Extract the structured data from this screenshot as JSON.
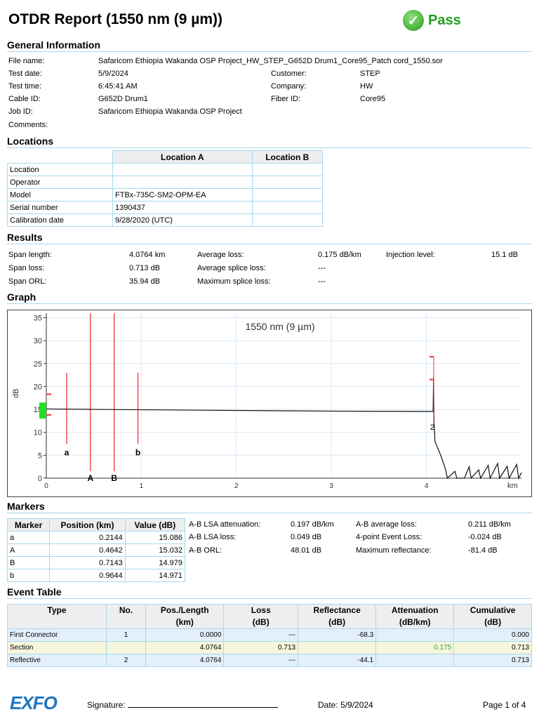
{
  "header": {
    "title": "OTDR Report (1550 nm (9 µm))",
    "status": "Pass"
  },
  "general": {
    "heading": "General Information",
    "file_name_label": "File name:",
    "file_name": "Safaricom Ethiopia Wakanda OSP Project_HW_STEP_G652D Drum1_Core95_Patch cord_1550.sor",
    "test_date_label": "Test date:",
    "test_date": "5/9/2024",
    "test_time_label": "Test time:",
    "test_time": "6:45:41 AM",
    "cable_id_label": "Cable ID:",
    "cable_id": "G652D Drum1",
    "job_id_label": "Job ID:",
    "job_id": "Safaricom Ethiopia Wakanda OSP Project",
    "comments_label": "Comments:",
    "customer_label": "Customer:",
    "customer": "STEP",
    "company_label": "Company:",
    "company": "HW",
    "fiber_id_label": "Fiber ID:",
    "fiber_id": "Core95"
  },
  "locations": {
    "heading": "Locations",
    "col_a": "Location A",
    "col_b": "Location B",
    "rows": [
      {
        "label": "Location",
        "a": "",
        "b": ""
      },
      {
        "label": "Operator",
        "a": "",
        "b": ""
      },
      {
        "label": "Model",
        "a": "FTBx-735C-SM2-OPM-EA",
        "b": ""
      },
      {
        "label": "Serial number",
        "a": "1390437",
        "b": ""
      },
      {
        "label": "Calibration date",
        "a": "9/28/2020 (UTC)",
        "b": ""
      }
    ]
  },
  "results": {
    "heading": "Results",
    "span_length_label": "Span length:",
    "span_length": "4.0764 km",
    "span_loss_label": "Span loss:",
    "span_loss": "0.713 dB",
    "span_orl_label": "Span ORL:",
    "span_orl": "35.94 dB",
    "avg_loss_label": "Average loss:",
    "avg_loss": "0.175 dB/km",
    "avg_splice_label": "Average splice loss:",
    "avg_splice": "---",
    "max_splice_label": "Maximum splice loss:",
    "max_splice": "---",
    "injection_label": "Injection level:",
    "injection": "15.1 dB"
  },
  "graph": {
    "heading": "Graph"
  },
  "chart_data": {
    "type": "line",
    "title": "1550 nm (9 µm)",
    "xlabel": "km",
    "ylabel": "dB",
    "xlim": [
      0,
      5
    ],
    "ylim": [
      0,
      36
    ],
    "xticks": [
      "0",
      "1",
      "2",
      "3",
      "4"
    ],
    "yticks": [
      "0",
      "5",
      "10",
      "15",
      "20",
      "25",
      "30",
      "35"
    ],
    "trace": [
      [
        0,
        15.1
      ],
      [
        0.5,
        15.0
      ],
      [
        1.5,
        14.85
      ],
      [
        3.2,
        14.6
      ],
      [
        4.07,
        14.55
      ],
      [
        4.075,
        22
      ],
      [
        4.08,
        12
      ],
      [
        4.09,
        8
      ],
      [
        4.15,
        5
      ],
      [
        4.2,
        2
      ],
      [
        4.22,
        0
      ],
      [
        4.3,
        1.5
      ],
      [
        4.32,
        0
      ],
      [
        4.4,
        0
      ],
      [
        4.45,
        2.5
      ],
      [
        4.47,
        0
      ],
      [
        4.55,
        1.8
      ],
      [
        4.57,
        0
      ],
      [
        4.65,
        2.8
      ],
      [
        4.67,
        0
      ],
      [
        4.75,
        3.2
      ],
      [
        4.77,
        0
      ],
      [
        4.85,
        2.6
      ],
      [
        4.87,
        0
      ],
      [
        4.95,
        3
      ],
      [
        4.97,
        0
      ],
      [
        5,
        1.2
      ]
    ],
    "markers": [
      {
        "label": "a",
        "x": 0.2144
      },
      {
        "label": "A",
        "x": 0.4642
      },
      {
        "label": "B",
        "x": 0.7143
      },
      {
        "label": "b",
        "x": 0.9644
      }
    ],
    "event_label": "2"
  },
  "markers": {
    "heading": "Markers",
    "cols": [
      "Marker",
      "Position (km)",
      "Value (dB)"
    ],
    "rows": [
      {
        "m": "a",
        "p": "0.2144",
        "v": "15.086"
      },
      {
        "m": "A",
        "p": "0.4642",
        "v": "15.032"
      },
      {
        "m": "B",
        "p": "0.7143",
        "v": "14.979"
      },
      {
        "m": "b",
        "p": "0.9644",
        "v": "14.971"
      }
    ],
    "lsa_att_label": "A-B LSA attenuation:",
    "lsa_att": "0.197 dB/km",
    "lsa_loss_label": "A-B LSA loss:",
    "lsa_loss": "0.049 dB",
    "orl_label": "A-B ORL:",
    "orl": "48.01 dB",
    "avg_loss_label": "A-B average loss:",
    "avg_loss": "0.211 dB/km",
    "event_loss_label": "4-point Event Loss:",
    "event_loss": "-0.024 dB",
    "max_refl_label": "Maximum reflectance:",
    "max_refl": "-81.4 dB"
  },
  "events": {
    "heading": "Event Table",
    "cols": [
      [
        "Type",
        ""
      ],
      [
        "No.",
        ""
      ],
      [
        "Pos./Length",
        "(km)"
      ],
      [
        "Loss",
        "(dB)"
      ],
      [
        "Reflectance",
        "(dB)"
      ],
      [
        "Attenuation",
        "(dB/km)"
      ],
      [
        "Cumulative",
        "(dB)"
      ]
    ],
    "rows": [
      [
        "First Connector",
        "1",
        "0.0000",
        "---",
        "-68.3",
        "",
        "0.000"
      ],
      [
        "Section",
        "",
        "4.0764",
        "0.713",
        "",
        "0.175",
        "0.713"
      ],
      [
        "Reflective",
        "2",
        "4.0764",
        "---",
        "-44.1",
        "",
        "0.713"
      ]
    ],
    "attenuation_color": "#3aa53a"
  },
  "footer": {
    "logo": "EXFO",
    "signature_label": "Signature:",
    "date": "Date: 5/9/2024",
    "page": "Page 1 of 4"
  }
}
